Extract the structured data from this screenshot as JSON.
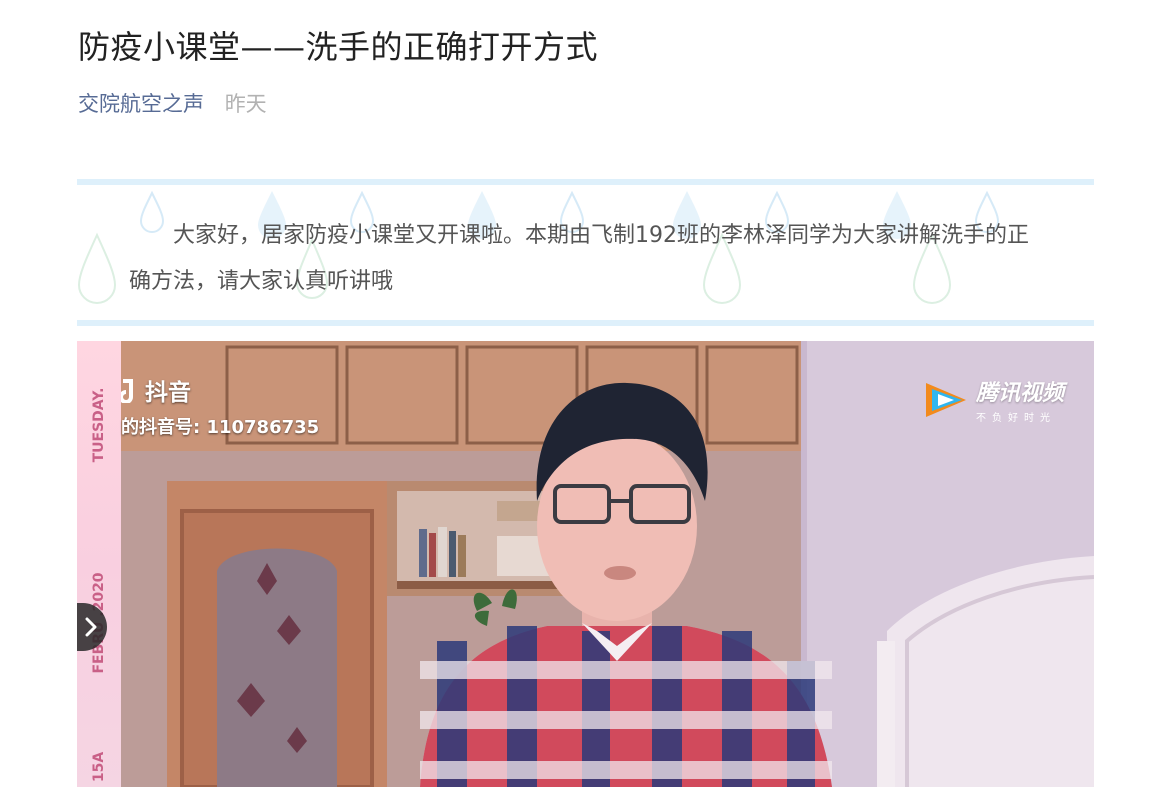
{
  "article": {
    "title": "防疫小课堂——洗手的正确打开方式",
    "author": "交院航空之声",
    "date": "昨天"
  },
  "intro": {
    "text": "大家好，居家防疫小课堂又开课啦。本期由飞制192班的李林泽同学为大家讲解洗手的正确方法，请大家认真听讲哦"
  },
  "video": {
    "date_strip": {
      "day": "TUESDAY.",
      "month_year": "FEBRU  .2020",
      "day_number": "15A"
    },
    "douyin": {
      "brand": "抖音",
      "id_text": "的抖音号: 110786735"
    },
    "tencent": {
      "brand": "腾讯视频",
      "slogan": "不负好时光"
    },
    "colors": {
      "wall": "#c7a6a3",
      "cabinet": "#c08a6c",
      "shirt_red": "#c62f45",
      "shirt_blue": "#2b3a7a"
    }
  },
  "icons": {
    "next_arrow": "chevron-right-icon",
    "douyin_logo": "douyin-icon",
    "tencent_logo": "tencent-video-icon"
  }
}
